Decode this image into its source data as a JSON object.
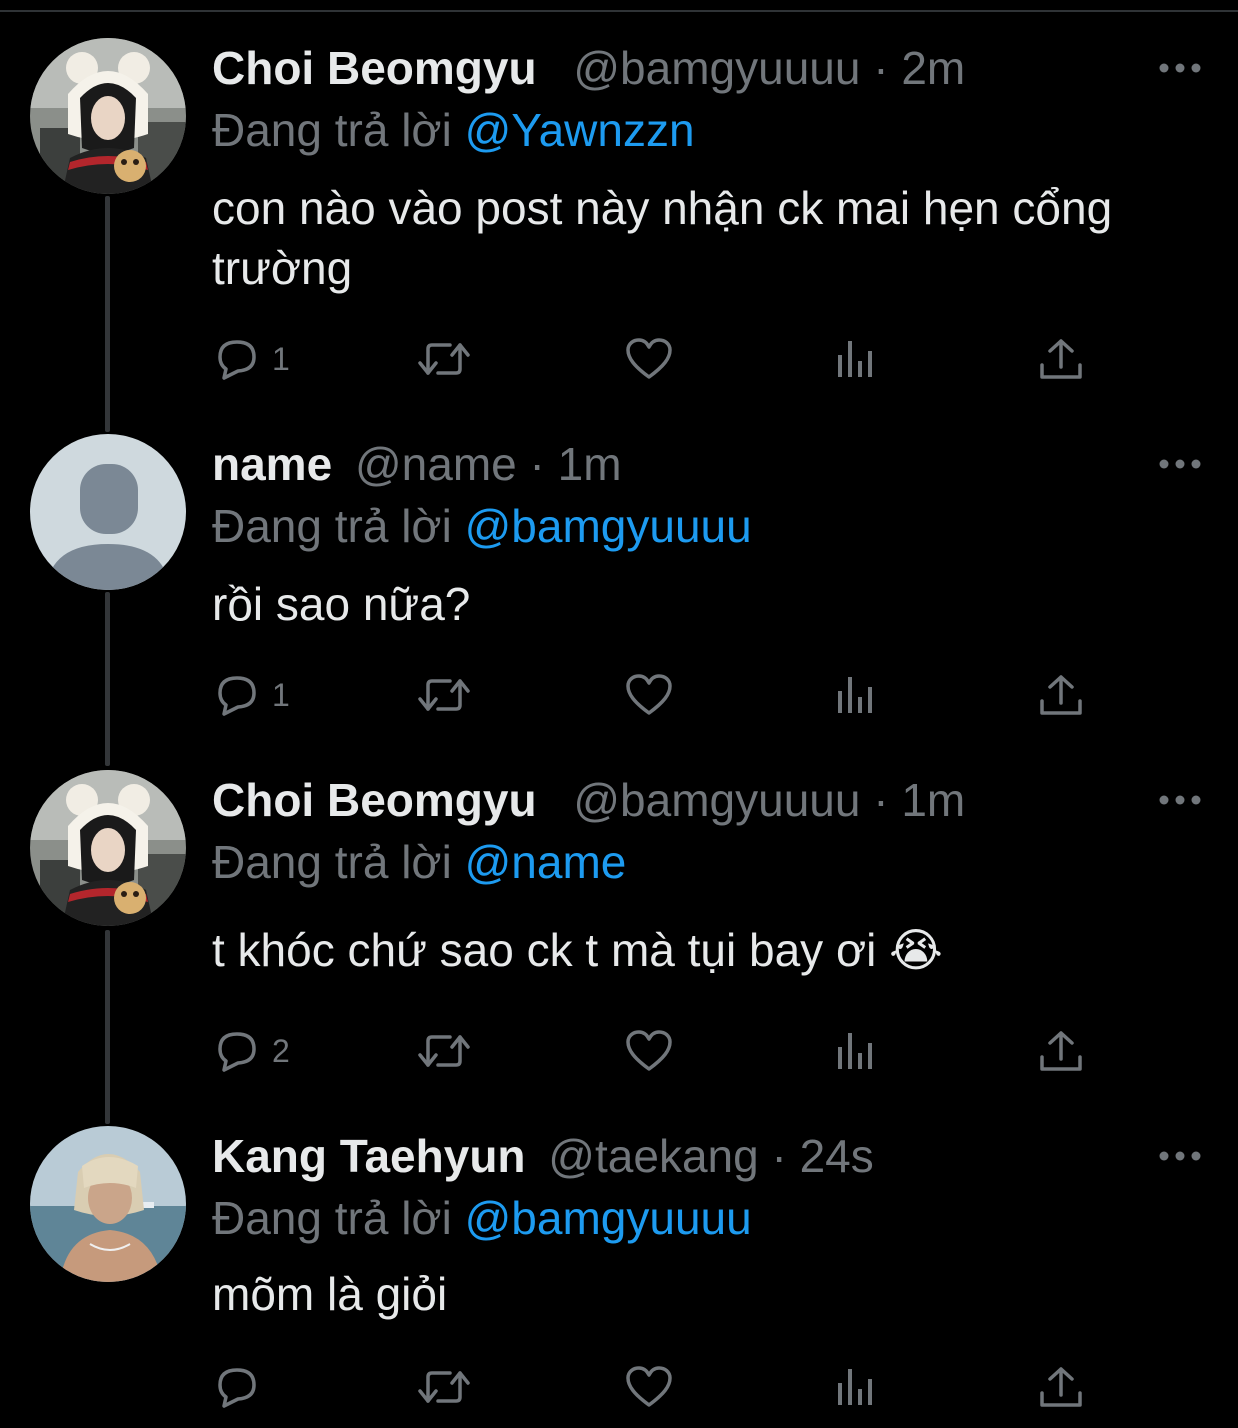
{
  "theme": {
    "background": "#000000",
    "text": "#e7e9ea",
    "muted": "#71767b",
    "accent": "#1d9bf0",
    "thread_line": "#333639"
  },
  "tweets": [
    {
      "display_name": "Choi Beomgyu",
      "handle": "@bamgyuuuu",
      "separator": "·",
      "time": "2m",
      "reply_prefix": "Đang trả lời",
      "reply_to": "@Yawnzzn",
      "text": "con nào vào post này nhận ck mai hẹn cổng trường",
      "reply_count": "1",
      "avatar": "photo-avatar-beomgyu"
    },
    {
      "display_name": "name",
      "handle": "@name",
      "separator": "·",
      "time": "1m",
      "reply_prefix": "Đang trả lời",
      "reply_to": "@bamgyuuuu",
      "text": "rồi sao nữa?",
      "reply_count": "1",
      "avatar": "default-avatar"
    },
    {
      "display_name": "Choi Beomgyu",
      "handle": "@bamgyuuuu",
      "separator": "·",
      "time": "1m",
      "reply_prefix": "Đang trả lời",
      "reply_to": "@name",
      "text": "t khóc chứ sao ck t mà tụi bay ơi 😭",
      "reply_count": "2",
      "avatar": "photo-avatar-beomgyu"
    },
    {
      "display_name": "Kang Taehyun",
      "handle": "@taekang",
      "separator": "·",
      "time": "24s",
      "reply_prefix": "Đang trả lời",
      "reply_to": "@bamgyuuuu",
      "text": "mõm là giỏi",
      "reply_count": "",
      "avatar": "photo-avatar-taehyun"
    }
  ],
  "icons": {
    "more": "more-options-icon",
    "reply": "reply-icon",
    "retweet": "retweet-icon",
    "like": "like-icon",
    "views": "views-icon",
    "share": "share-icon"
  }
}
